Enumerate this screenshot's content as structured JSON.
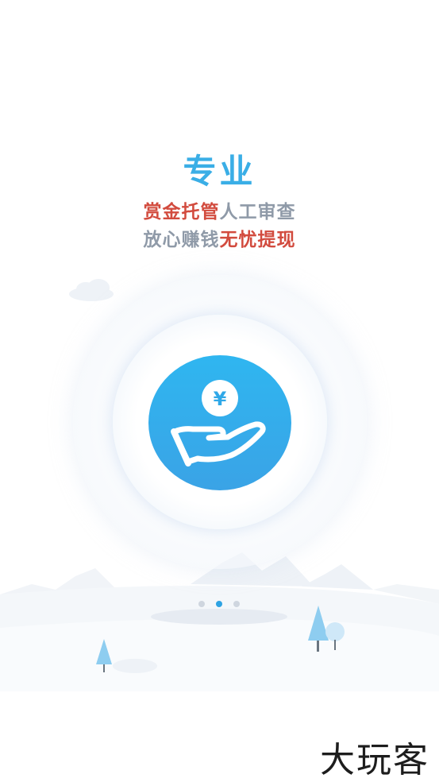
{
  "intro": {
    "title": "专业",
    "line1_part1": "赏金托管",
    "line1_part2": "人工审查",
    "line2_part1": "放心赚钱",
    "line2_part2": "无忧提现"
  },
  "icon": {
    "symbol": "¥",
    "name": "money-in-hand-icon"
  },
  "pager": {
    "total": 3,
    "active_index": 1
  },
  "watermark": {
    "text": "大玩客"
  },
  "colors": {
    "accent": "#3aaee6",
    "highlight": "#d24b3e",
    "muted": "#8f9aa8"
  }
}
